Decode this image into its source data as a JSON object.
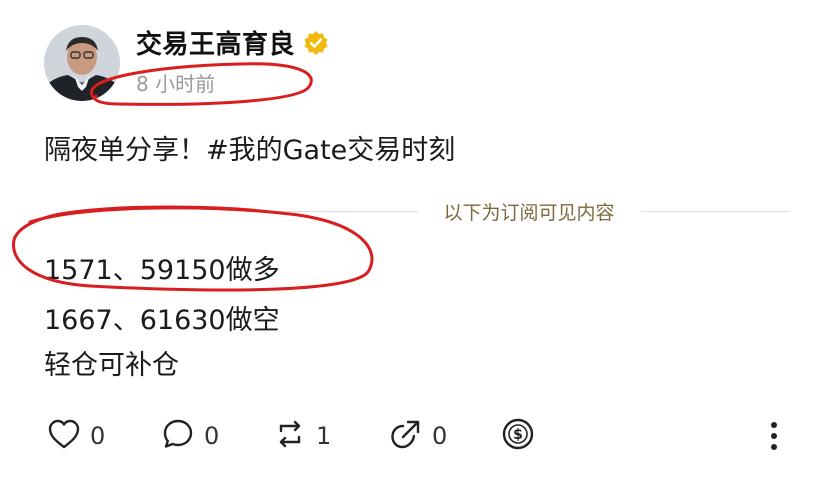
{
  "post": {
    "author": "交易王高育良",
    "time": "8 小时前",
    "text": "隔夜单分享！#我的Gate交易时刻",
    "divider_label": "以下为订阅可见内容",
    "lines": [
      "1571、59150做多",
      "1667、61630做空",
      "轻仓可补仓"
    ]
  },
  "actions": {
    "like_count": "0",
    "comment_count": "0",
    "repost_count": "1",
    "share_count": "0"
  },
  "icons": {
    "verified": "verified-badge-icon",
    "like": "heart-icon",
    "comment": "comment-icon",
    "repost": "repost-icon",
    "share": "share-icon",
    "tip": "dollar-coin-icon",
    "more": "more-vertical-icon"
  },
  "colors": {
    "verified": "#f0b90b",
    "annotation": "#d81e1e",
    "divider_text": "#7b6a3c"
  }
}
